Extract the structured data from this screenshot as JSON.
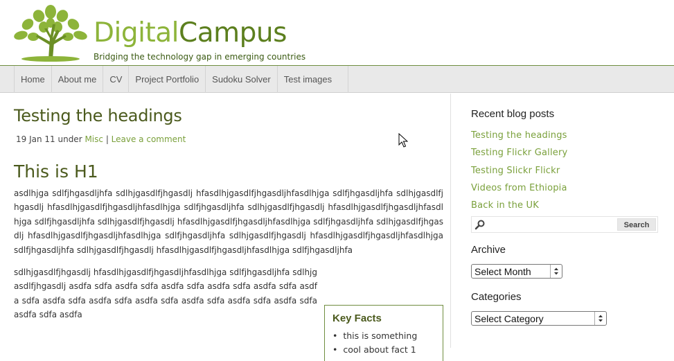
{
  "header": {
    "brand_part1": "Digital",
    "brand_part2": "Campus",
    "tagline": "Bridging the technology gap in emerging countries",
    "logo_icon": "tree-logo-icon",
    "colors": {
      "brand_light": "#8db43a",
      "brand_dark": "#5c7f1e"
    }
  },
  "nav": {
    "items": [
      "Home",
      "About me",
      "CV",
      "Project Portfolio",
      "Sudoku Solver",
      "Test images"
    ]
  },
  "post": {
    "title": "Testing the headings",
    "date_prefix": "19 Jan 11 under ",
    "category": "Misc",
    "separator": " | ",
    "comment_link": "Leave a comment",
    "h1": "This is H1",
    "paragraph1": "asdlhjga sdlfjhgasdljhfa sdlhjgasdlfjhgasdlj hfasdlhjgasdlfjhgasdljhfasdlhjga sdlfjhgasdljhfa sdlhjgasdlfjhgasdlj hfasdlhjgasdlfjhgasdljhfasdlhjga sdlfjhgasdljhfa sdlhjgasdlfjhgasdlj hfasdlhjgasdlfjhgasdljhfasdlhjga sdlfjhgasdljhfa sdlhjgasdlfjhgasdlj hfasdlhjgasdlfjhgasdljhfasdlhjga sdlfjhgasdljhfa sdlhjgasdlfjhgasdlj hfasdlhjgasdlfjhgasdljhfasdlhjga sdlfjhgasdljhfa sdlhjgasdlfjhgasdlj hfasdlhjgasdlfjhgasdljhfasdlhjga sdlfjhgasdljhfa sdlhjgasdlfjhgasdlj hfasdlhjgasdlfjhgasdljhfasdlhjga sdlfjhgasdljhfa",
    "paragraph2": "sdlhjgasdlfjhgasdlj hfasdlhjgasdlfjhgasdljhfasdlhjga sdlfjhgasdljhfa sdlhjgasdlfjhgasdlj asdfa sdfa asdfa sdfa asdfa sdfa asdfa sdfa asdfa sdfa asdfa sdfa asdfa sdfa asdfa sdfa asdfa sdfa asdfa sdfa asdfa sdfa asdfa sdfa asdfa sdfa asdfa"
  },
  "keyfacts": {
    "title": "Key Facts",
    "item1": "this is something",
    "item2": "cool about fact 1"
  },
  "sidebar": {
    "recent_heading": "Recent blog posts",
    "recent_posts": [
      "Testing the headings",
      "Testing Flickr Gallery",
      "Testing Slickr Flickr",
      "Videos from Ethiopia",
      "Back in the UK"
    ],
    "search_button": "Search",
    "search_value": "",
    "archive_heading": "Archive",
    "archive_select": "Select Month",
    "categories_heading": "Categories",
    "categories_select": "Select Category",
    "link_color": "#7aa03b"
  }
}
